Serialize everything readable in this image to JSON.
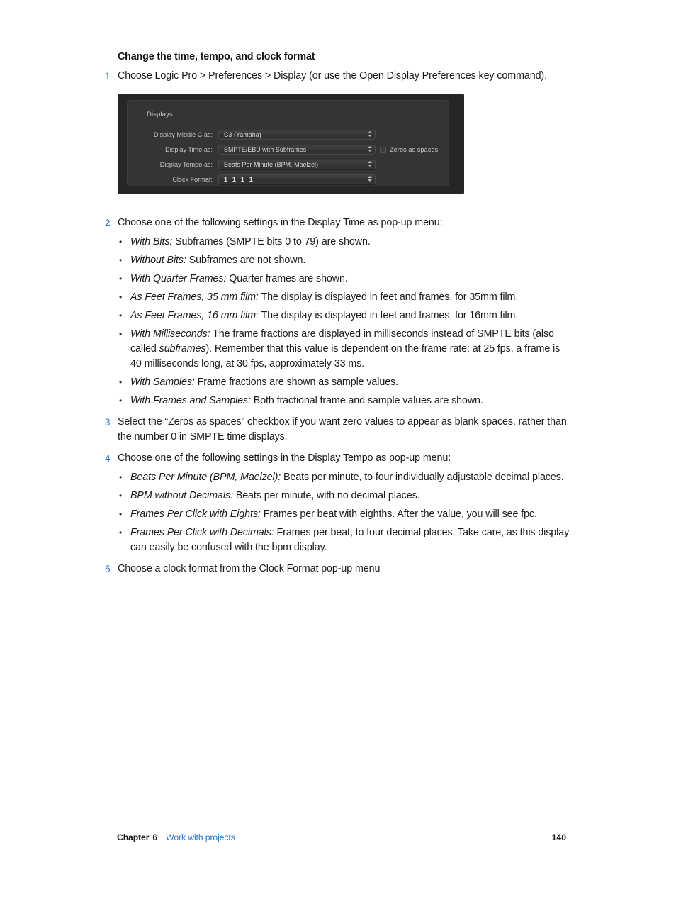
{
  "document": {
    "heading": "Change the time, tempo, and clock format"
  },
  "steps": {
    "step1": {
      "num": "1",
      "text": "Choose Logic Pro > Preferences > Display (or use the Open Display Preferences key command)."
    },
    "step2": {
      "num": "2",
      "text": "Choose one of the following settings in the Display Time as pop-up menu:"
    },
    "step3": {
      "num": "3",
      "text": "Select the “Zeros as spaces” checkbox if you want zero values to appear as blank spaces, rather than the number 0 in SMPTE time displays."
    },
    "step4": {
      "num": "4",
      "text": "Choose one of the following settings in the Display Tempo as pop-up menu:"
    },
    "step5": {
      "num": "5",
      "text": "Choose a clock format from the Clock Format pop-up menu"
    }
  },
  "bullet_marker": "•",
  "time_bullets": [
    {
      "term": "With Bits:",
      "text": "Subframes (SMPTE bits 0 to 79) are shown."
    },
    {
      "term": "Without Bits:",
      "text": "Subframes are not shown."
    },
    {
      "term": "With Quarter Frames:",
      "text": "Quarter frames are shown."
    },
    {
      "term": "As Feet Frames, 35 mm film:",
      "text": "The display is displayed in feet and frames, for 35mm film."
    },
    {
      "term": "As Feet Frames, 16 mm film:",
      "text": "The display is displayed in feet and frames, for 16mm film."
    },
    {
      "term": "With Milliseconds:",
      "text_part1": "The frame fractions are displayed in milliseconds instead of SMPTE bits (also called ",
      "text_italic": "subframes",
      "text_part2": "). Remember that this value is dependent on the frame rate: at 25 fps, a frame is 40 milliseconds long, at 30 fps, approximately 33 ms."
    },
    {
      "term": "With Samples:",
      "text": "Frame fractions are shown as sample values."
    },
    {
      "term": "With Frames and Samples:",
      "text": "Both fractional frame and sample values are shown."
    }
  ],
  "tempo_bullets": [
    {
      "term": "Beats Per Minute (BPM, Maelzel):",
      "text": "Beats per minute, to four individually adjustable decimal places."
    },
    {
      "term": "BPM without Decimals:",
      "text": "Beats per minute, with no decimal places."
    },
    {
      "term": "Frames Per Click with Eights:",
      "text": "Frames per beat with eighths. After the value, you will see fpc."
    },
    {
      "term": "Frames Per Click with Decimals:",
      "text": "Frames per beat, to four decimal places. Take care, as this display can easily be confused with the bpm display."
    }
  ],
  "figure": {
    "section_title": "Displays",
    "rows": [
      {
        "label": "Display Middle C as:",
        "value": "C3 (Yamaha)"
      },
      {
        "label": "Display Time as:",
        "value": "SMPTE/EBU with Subframes"
      },
      {
        "label": "Display Tempo as:",
        "value": "Beats Per Minute (BPM, Maelzel)"
      },
      {
        "label": "Clock Format:",
        "value": "1  1  1  1"
      }
    ],
    "checkbox": {
      "label": "Zeros as spaces",
      "checked": false
    }
  },
  "footer": {
    "chapter_label": "Chapter",
    "chapter_number": "6",
    "chapter_title": "Work with projects",
    "page_number": "140"
  },
  "colors": {
    "step_number": "#2b79cc",
    "link": "#2b79cc",
    "panel_bg": "#343434",
    "panel_frame": "#262626"
  }
}
